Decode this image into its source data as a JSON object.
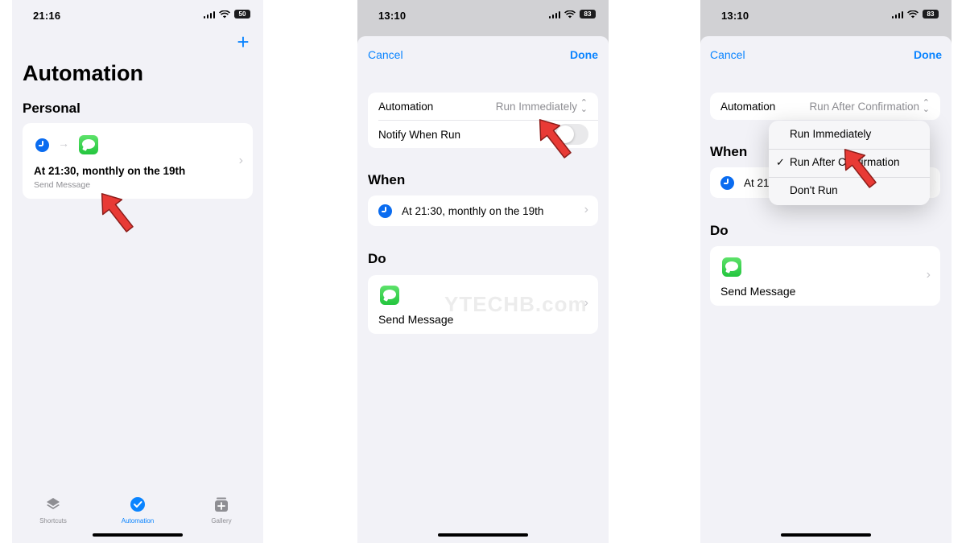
{
  "panel1": {
    "status_time": "21:16",
    "battery": "50",
    "title": "Automation",
    "section": "Personal",
    "automation_card": {
      "title": "At 21:30, monthly on the 19th",
      "subtitle": "Send Message"
    },
    "tabs": [
      {
        "label": "Shortcuts",
        "icon": "layers-icon",
        "selected": false
      },
      {
        "label": "Automation",
        "icon": "checkmark-circle-icon",
        "selected": true
      },
      {
        "label": "Gallery",
        "icon": "gallery-icon",
        "selected": false
      }
    ]
  },
  "panel2": {
    "status_time": "13:10",
    "battery": "83",
    "cancel": "Cancel",
    "done": "Done",
    "automation_label": "Automation",
    "automation_value": "Run Immediately",
    "notify_label": "Notify When Run",
    "notify_on": false,
    "when_header": "When",
    "when_value": "At 21:30, monthly on the 19th",
    "do_header": "Do",
    "do_action": "Send Message",
    "watermark": "YTECHB.com"
  },
  "panel3": {
    "status_time": "13:10",
    "battery": "83",
    "cancel": "Cancel",
    "done": "Done",
    "automation_label": "Automation",
    "automation_value": "Run After Confirmation",
    "when_header": "When",
    "when_value": "At 21",
    "do_header": "Do",
    "do_action": "Send Message",
    "menu": [
      {
        "label": "Run Immediately",
        "checked": false
      },
      {
        "label": "Run After Confirmation",
        "checked": true
      },
      {
        "label": "Don't Run",
        "checked": false
      }
    ]
  },
  "colors": {
    "accent": "#0a84ff",
    "background": "#f2f2f7",
    "arrow": "#e83a35"
  }
}
